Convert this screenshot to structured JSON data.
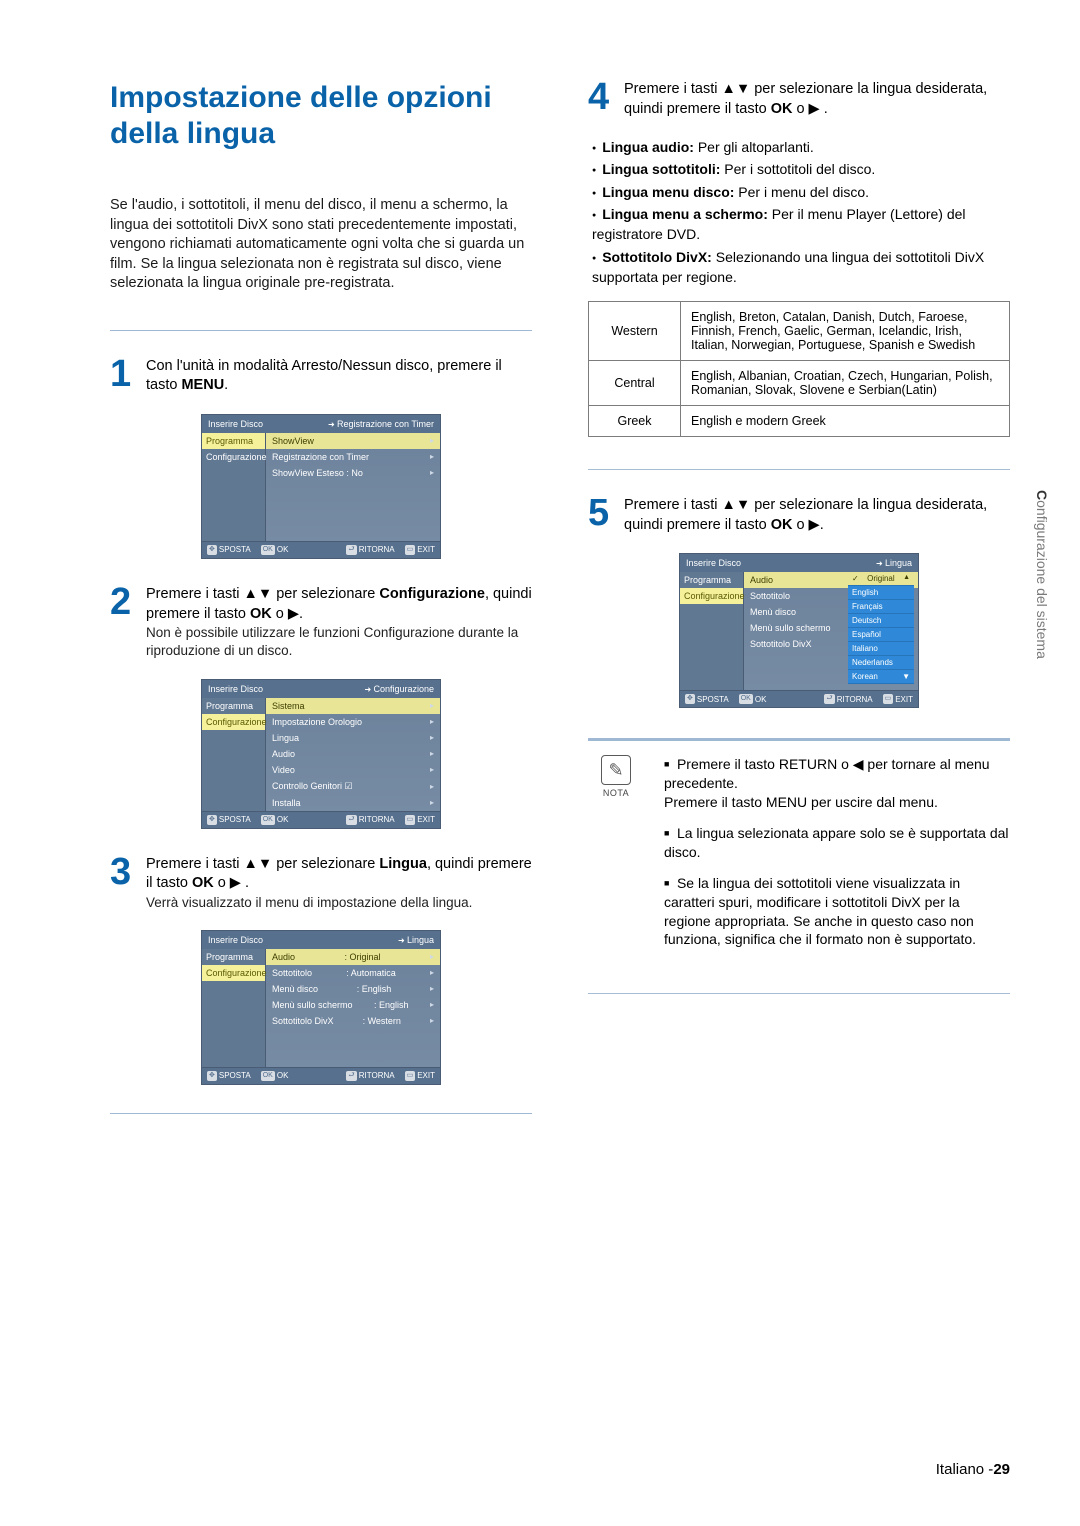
{
  "header": {
    "title": "Impostazione delle opzioni della lingua"
  },
  "intro": "Se l'audio, i sottotitoli, il menu del disco, il menu a schermo, la lingua dei sottotitoli DivX sono stati precedentemente impostati, vengono richiamati automaticamente ogni volta che si guarda un film. Se la lingua selezionata non è registrata sul disco, viene selezionata la lingua originale pre-registrata.",
  "steps": {
    "s1": {
      "num": "1",
      "text_a": "Con l'unità in modalità Arresto/Nessun disco, premere il tasto ",
      "text_b": "MENU",
      "text_c": "."
    },
    "s2": {
      "num": "2",
      "text_a": "Premere i tasti ",
      "arrows": "▲▼",
      "text_b": " per selezionare ",
      "bold": "Configurazione",
      "text_c": ", quindi premere il tasto ",
      "okbtn": "OK",
      "text_d": " o ▶.",
      "sub": "Non è possibile utilizzare le funzioni Configurazione durante la riproduzione di un disco."
    },
    "s3": {
      "num": "3",
      "text_a": "Premere i tasti ",
      "arrows": "▲▼",
      "text_b": " per selezionare ",
      "bold": "Lingua",
      "text_c": ", quindi premere il tasto ",
      "okbtn": "OK",
      "text_d": " o ▶ .",
      "sub": "Verrà visualizzato il menu di impostazione della lingua."
    },
    "s4": {
      "num": "4",
      "text_a": "Premere i tasti ",
      "arrows": "▲▼",
      "text_b": " per selezionare la lingua desiderata, quindi premere il tasto ",
      "okbtn": "OK",
      "text_c": " o ▶ ."
    },
    "s5": {
      "num": "5",
      "text_a": "Premere i tasti ",
      "arrows": "▲▼",
      "text_b": " per selezionare la lingua desiderata, quindi premere il tasto ",
      "okbtn": "OK",
      "text_c": " o ▶."
    }
  },
  "s4_bullets": [
    {
      "label": "Lingua audio:",
      "desc": " Per gli altoparlanti."
    },
    {
      "label": "Lingua sottotitoli:",
      "desc": " Per i sottotitoli del disco."
    },
    {
      "label": "Lingua menu disco:",
      "desc": " Per i menu del disco."
    },
    {
      "label": "Lingua menu a schermo:",
      "desc": " Per il menu Player (Lettore) del registratore DVD."
    },
    {
      "label": "Sottotitolo DivX:",
      "desc": " Selezionando una lingua dei sottotitoli DivX supportata per regione."
    }
  ],
  "lang_table": [
    {
      "region": "Western",
      "langs": "English, Breton, Catalan, Danish, Dutch, Faroese, Finnish, French, Gaelic, German, Icelandic, Irish, Italian, Norwegian, Portuguese, Spanish e Swedish"
    },
    {
      "region": "Central",
      "langs": "English, Albanian, Croatian, Czech, Hungarian, Polish, Romanian, Slovak, Slovene e Serbian(Latin)"
    },
    {
      "region": "Greek",
      "langs": "English e modern Greek"
    }
  ],
  "menu1": {
    "title": "Inserire Disco",
    "crumb": "Registrazione con Timer",
    "side": [
      "Programma",
      "Configurazione"
    ],
    "items": [
      "ShowView",
      "Registrazione con Timer",
      "ShowView Esteso : No"
    ],
    "footer": {
      "a": "SPOSTA",
      "b": "OK",
      "c": "RITORNA",
      "d": "EXIT"
    }
  },
  "menu2": {
    "title": "Inserire Disco",
    "crumb": "Configurazione",
    "side": [
      "Programma",
      "Configurazione"
    ],
    "items": [
      "Sistema",
      "Impostazione Orologio",
      "Lingua",
      "Audio",
      "Video",
      "Controllo Genitori ☑",
      "Installa"
    ],
    "footer": {
      "a": "SPOSTA",
      "b": "OK",
      "c": "RITORNA",
      "d": "EXIT"
    }
  },
  "menu3": {
    "title": "Inserire Disco",
    "crumb": "Lingua",
    "side": [
      "Programma",
      "Configurazione"
    ],
    "items": [
      {
        "k": "Audio",
        "v": ": Original"
      },
      {
        "k": "Sottotitolo",
        "v": ": Automatica"
      },
      {
        "k": "Menù disco",
        "v": ": English"
      },
      {
        "k": "Menù sullo schermo",
        "v": ": English"
      },
      {
        "k": "Sottotitolo DivX",
        "v": ": Western"
      }
    ],
    "footer": {
      "a": "SPOSTA",
      "b": "OK",
      "c": "RITORNA",
      "d": "EXIT"
    }
  },
  "menu5": {
    "title": "Inserire Disco",
    "crumb": "Lingua",
    "side": [
      "Programma",
      "Configurazione"
    ],
    "items": [
      "Audio",
      "Sottotitolo",
      "Menù disco",
      "Menù sullo schermo",
      "Sottotitolo DivX"
    ],
    "langsel": [
      "Original",
      "English",
      "Français",
      "Deutsch",
      "Español",
      "Italiano",
      "Nederlands",
      "Korean"
    ],
    "footer": {
      "a": "SPOSTA",
      "b": "OK",
      "c": "RITORNA",
      "d": "EXIT"
    }
  },
  "note": {
    "label": "NOTA",
    "items": [
      "Premere il tasto RETURN o ◀ per tornare al menu precedente.\nPremere il tasto MENU per uscire dal menu.",
      "La lingua selezionata appare solo se è supportata dal disco.",
      "Se la lingua dei sottotitoli viene visualizzata in caratteri spuri, modificare i sottotitoli DivX per la regione appropriata. Se anche in questo caso non funziona, significa che il formato non è supportato."
    ]
  },
  "sidetab": {
    "bold": "C",
    "rest": "onfigurazione del sistema"
  },
  "page_footer": {
    "lang": "Italiano -",
    "num": "29"
  }
}
